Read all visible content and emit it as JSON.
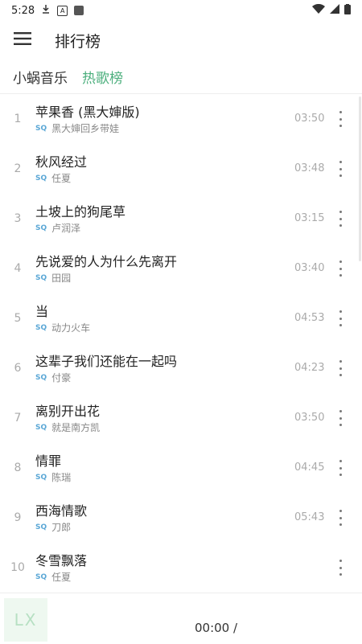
{
  "status": {
    "time": "5:28"
  },
  "toolbar": {
    "title": "排行榜"
  },
  "tabs": [
    {
      "label": "小蜗音乐"
    },
    {
      "label": "热歌榜"
    }
  ],
  "songs": [
    {
      "num": "1",
      "title": "苹果香 (黑大婶版)",
      "quality": "SQ",
      "artist": "黑大婶回乡带娃",
      "duration": "03:50"
    },
    {
      "num": "2",
      "title": "秋风经过",
      "quality": "SQ",
      "artist": "任夏",
      "duration": "03:48"
    },
    {
      "num": "3",
      "title": "土坡上的狗尾草",
      "quality": "SQ",
      "artist": "卢润泽",
      "duration": "03:15"
    },
    {
      "num": "4",
      "title": "先说爱的人为什么先离开",
      "quality": "SQ",
      "artist": "田园",
      "duration": "03:40"
    },
    {
      "num": "5",
      "title": "当",
      "quality": "SQ",
      "artist": "动力火车",
      "duration": "04:53"
    },
    {
      "num": "6",
      "title": "这辈子我们还能在一起吗",
      "quality": "SQ",
      "artist": "付豪",
      "duration": "04:23"
    },
    {
      "num": "7",
      "title": "离别开出花",
      "quality": "SQ",
      "artist": "就是南方凯",
      "duration": "03:50"
    },
    {
      "num": "8",
      "title": "情罪",
      "quality": "SQ",
      "artist": "陈瑞",
      "duration": "04:45"
    },
    {
      "num": "9",
      "title": "西海情歌",
      "quality": "SQ",
      "artist": "刀郎",
      "duration": "05:43"
    },
    {
      "num": "10",
      "title": "冬雪飘落",
      "quality": "SQ",
      "artist": "任夏",
      "duration": ""
    }
  ],
  "player": {
    "logo": "LX",
    "time": "00:00 /"
  },
  "colors": {
    "accent": "#4caf7d",
    "sq": "#5aa7d6"
  }
}
